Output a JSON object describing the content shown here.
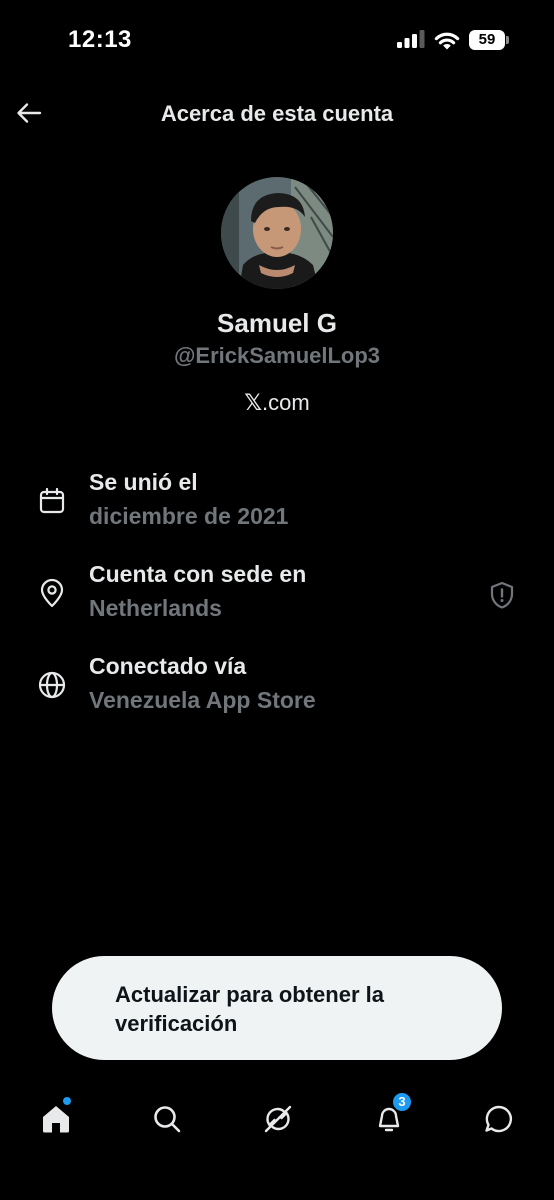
{
  "status_bar": {
    "time": "12:13",
    "battery": "59"
  },
  "header": {
    "title": "Acerca de esta cuenta"
  },
  "profile": {
    "display_name": "Samuel G",
    "handle": "@ErickSamuelLop3",
    "website_glyph": "𝕏",
    "website_suffix": ".com"
  },
  "info": {
    "joined": {
      "title": "Se unió el",
      "value": "diciembre de 2021",
      "icon": "calendar-icon"
    },
    "based": {
      "title": "Cuenta con sede en",
      "value": "Netherlands",
      "icon": "location-pin-icon"
    },
    "connected": {
      "title": "Conectado vía",
      "value": "Venezuela App Store",
      "icon": "globe-icon"
    }
  },
  "upsell": {
    "text": "Actualizar para obtener la verificación"
  },
  "nav": {
    "notifications_count": "3",
    "items": [
      "home-icon",
      "search-icon",
      "grok-icon",
      "notifications-icon",
      "messages-icon"
    ]
  },
  "colors": {
    "background": "#000000",
    "text": "#e7e9ea",
    "muted": "#71767b",
    "accent": "#1d9bf0",
    "pill": "#eff3f4"
  }
}
